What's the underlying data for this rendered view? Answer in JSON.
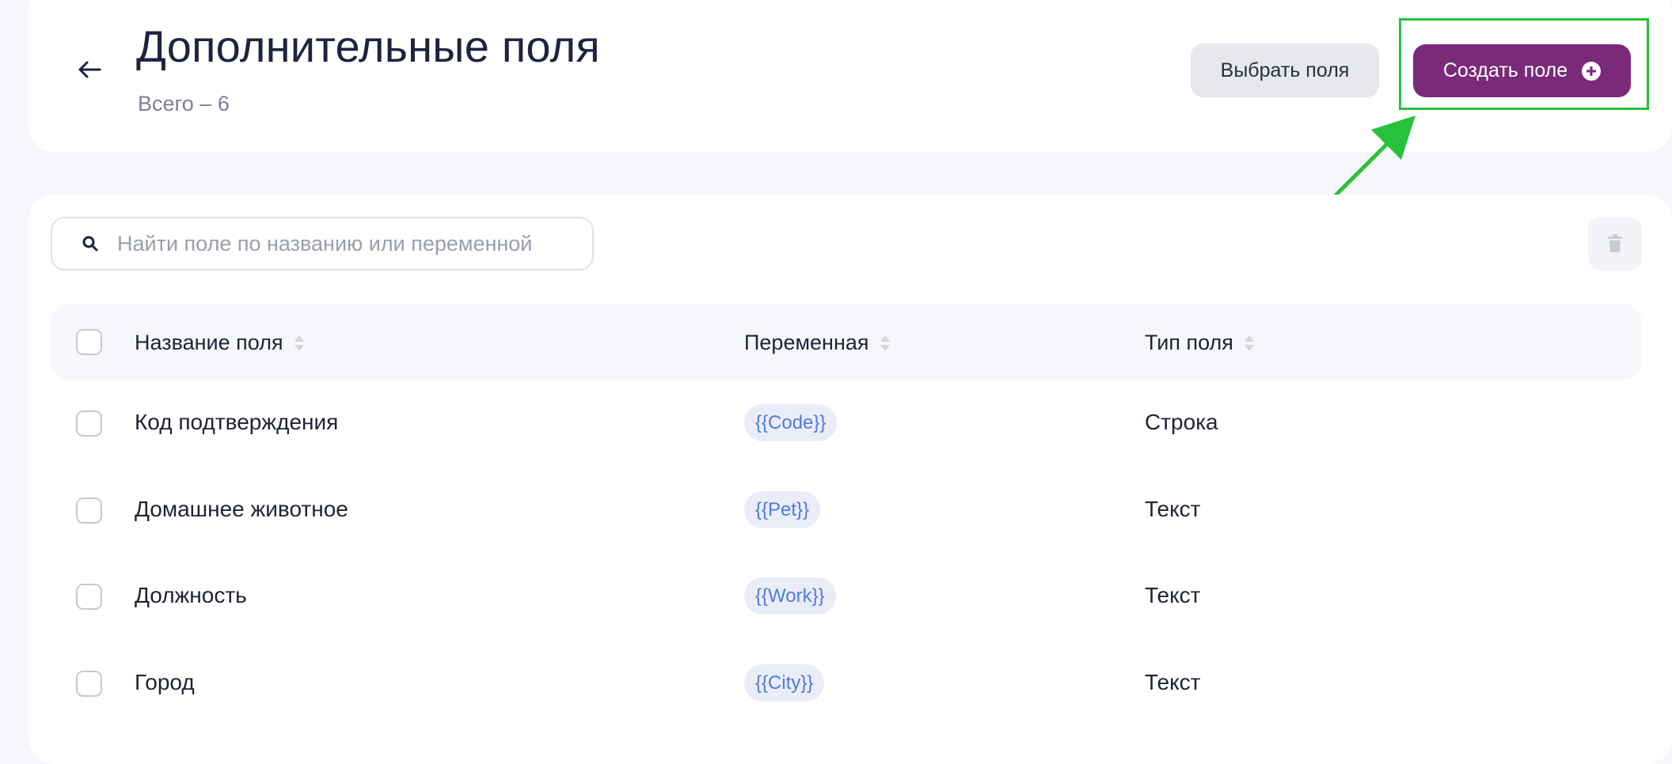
{
  "header": {
    "title": "Дополнительные поля",
    "subtitle": "Всего – 6",
    "select_button": "Выбрать поля",
    "create_button": "Создать поле"
  },
  "search": {
    "placeholder": "Найти поле по названию или переменной",
    "value": ""
  },
  "table": {
    "columns": [
      "Название поля",
      "Переменная",
      "Тип поля"
    ],
    "rows": [
      {
        "name": "Код подтверждения",
        "variable": "{{Code}}",
        "type": "Строка"
      },
      {
        "name": "Домашнее животное",
        "variable": "{{Pet}}",
        "type": "Текст"
      },
      {
        "name": "Должность",
        "variable": "{{Work}}",
        "type": "Текст"
      },
      {
        "name": "Город",
        "variable": "{{City}}",
        "type": "Текст"
      }
    ]
  },
  "icons": {
    "back": "arrow-left-icon",
    "create": "plus-circle-icon",
    "search": "search-icon",
    "delete": "trash-icon",
    "sort": "sort-icon"
  },
  "colors": {
    "primary": "#7b2a7a",
    "annotation": "#27c23c",
    "variable_text": "#4f7bd9",
    "variable_bg": "#eaedf8"
  }
}
